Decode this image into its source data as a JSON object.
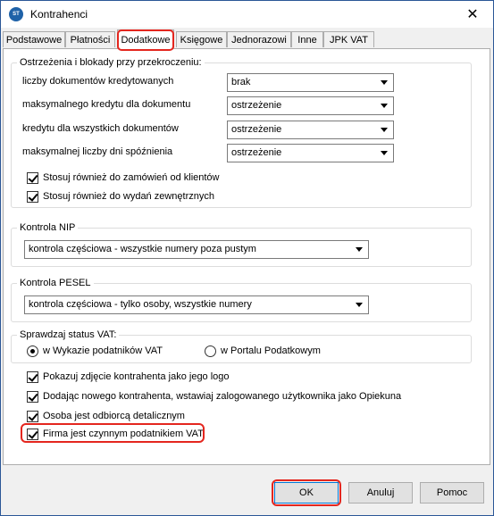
{
  "window": {
    "title": "Kontrahenci",
    "app_icon": "app-logo-icon",
    "close_glyph": "✕"
  },
  "tabs": [
    {
      "label": "Podstawowe"
    },
    {
      "label": "Płatności"
    },
    {
      "label": "Dodatkowe",
      "active": true
    },
    {
      "label": "Księgowe"
    },
    {
      "label": "Jednorazowi"
    },
    {
      "label": "Inne"
    },
    {
      "label": "JPK VAT"
    }
  ],
  "warnings": {
    "legend": "Ostrzeżenia i blokady przy przekroczeniu:",
    "rows": [
      {
        "label": "liczby dokumentów kredytowanych",
        "value": "brak"
      },
      {
        "label": "maksymalnego kredytu dla  dokumentu",
        "value": "ostrzeżenie"
      },
      {
        "label": "kredytu dla wszystkich dokumentów",
        "value": "ostrzeżenie"
      },
      {
        "label": "maksymalnej liczby dni spóźnienia",
        "value": "ostrzeżenie"
      }
    ],
    "checkboxes": [
      {
        "label": "Stosuj również do zamówień od klientów",
        "checked": true
      },
      {
        "label": "Stosuj również do wydań zewnętrznych",
        "checked": true
      }
    ]
  },
  "nip": {
    "legend": "Kontrola NIP",
    "value": "kontrola częściowa - wszystkie numery poza pustym"
  },
  "pesel": {
    "legend": "Kontrola PESEL",
    "value": "kontrola częściowa - tylko osoby, wszystkie numery"
  },
  "vat_status": {
    "legend": "Sprawdzaj status VAT:",
    "options": [
      {
        "label": "w Wykazie podatników VAT",
        "selected": true
      },
      {
        "label": "w Portalu Podatkowym",
        "selected": false
      }
    ]
  },
  "options": [
    {
      "label": "Pokazuj zdjęcie kontrahenta jako jego logo",
      "checked": true
    },
    {
      "label": "Dodając nowego kontrahenta, wstawiaj zalogowanego użytkownika jako Opiekuna",
      "checked": true
    },
    {
      "label": "Osoba jest odbiorcą detalicznym",
      "checked": true
    },
    {
      "label": "Firma jest czynnym podatnikiem VAT",
      "checked": true
    }
  ],
  "buttons": {
    "ok": "OK",
    "cancel": "Anuluj",
    "help": "Pomoc"
  },
  "colors": {
    "highlight": "#e4261e",
    "focus": "#0078d7"
  }
}
